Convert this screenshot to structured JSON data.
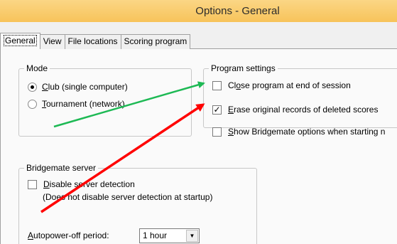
{
  "window": {
    "title": "Options - General"
  },
  "tabs": [
    {
      "label": "General",
      "active": true
    },
    {
      "label": "View"
    },
    {
      "label": "File locations"
    },
    {
      "label": "Scoring program"
    }
  ],
  "mode": {
    "title": "Mode",
    "options": [
      {
        "label_u": "C",
        "label_rest": "lub (single computer)",
        "selected": true
      },
      {
        "label_u": "T",
        "label_rest": "ournament (network)",
        "selected": false
      }
    ]
  },
  "program_settings": {
    "title": "Program settings",
    "items": [
      {
        "label_pre": "Cl",
        "label_u": "o",
        "label_rest": "se program at end of session",
        "checked": false,
        "mark": ""
      },
      {
        "label_pre": "",
        "label_u": "E",
        "label_rest": "rase original records of deleted scores",
        "checked": true,
        "mark": "✓"
      },
      {
        "label_pre": "",
        "label_u": "S",
        "label_rest": "how Bridgemate options when starting n",
        "checked": false,
        "mark": ""
      }
    ]
  },
  "bridgemate_server": {
    "title": "Bridgemate server",
    "disable": {
      "label_u": "D",
      "label_rest": "isable server detection",
      "checked": false
    },
    "note": "(Does not disable server detection at startup)",
    "autopower_label_u": "A",
    "autopower_label_rest": "utopower-off period:",
    "autopower_value": "1 hour"
  },
  "annotations": {
    "green_arrow_color": "#1db954",
    "red_arrow_color": "#ff0000"
  }
}
